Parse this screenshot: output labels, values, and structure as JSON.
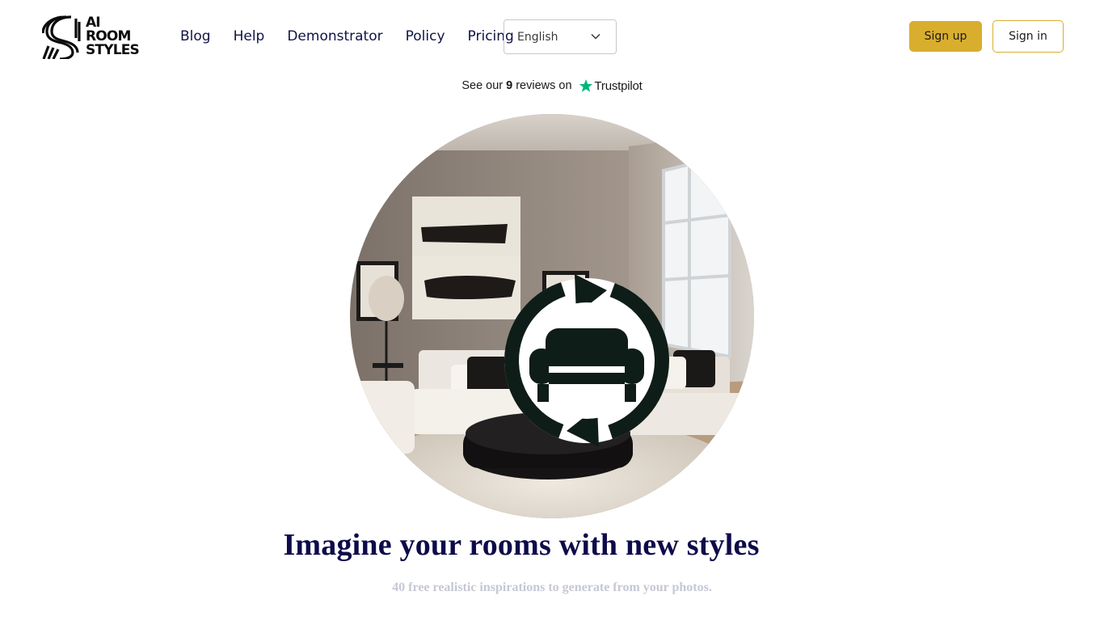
{
  "brand": {
    "logo_lines": [
      "AI",
      "ROOM",
      "STYLES"
    ]
  },
  "nav": {
    "items": [
      {
        "label": "Blog"
      },
      {
        "label": "Help"
      },
      {
        "label": "Demonstrator"
      },
      {
        "label": "Policy"
      },
      {
        "label": "Pricing"
      }
    ]
  },
  "language": {
    "selected": "English"
  },
  "auth": {
    "signup_label": "Sign up",
    "signin_label": "Sign in"
  },
  "trustpilot": {
    "prefix": "See our",
    "count": "9",
    "suffix": "reviews on",
    "brand": "Trustpilot"
  },
  "hero": {
    "title": "Imagine your rooms with new styles",
    "subtitle": "40 free realistic inspirations to generate from your photos."
  },
  "colors": {
    "accent": "#d9ae2e",
    "navy": "#0e0b4a",
    "trustpilot_green": "#00b67a"
  }
}
